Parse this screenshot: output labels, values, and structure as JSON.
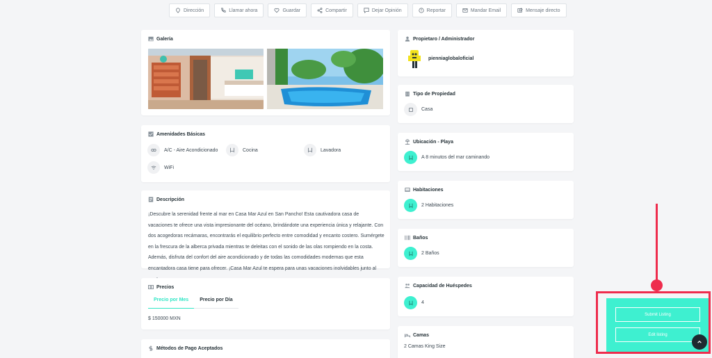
{
  "topbar": {
    "buttons": [
      {
        "label": "Dirección",
        "icon": "map-pin-icon"
      },
      {
        "label": "Llamar ahora",
        "icon": "phone-icon"
      },
      {
        "label": "Guardar",
        "icon": "heart-icon"
      },
      {
        "label": "Compartir",
        "icon": "share-icon"
      },
      {
        "label": "Dejar Opinión",
        "icon": "comment-icon"
      },
      {
        "label": "Reportar",
        "icon": "report-icon"
      },
      {
        "label": "Mandar Email",
        "icon": "email-icon"
      },
      {
        "label": "Mensaje directo",
        "icon": "message-icon"
      }
    ]
  },
  "gallery": {
    "title": "Galería"
  },
  "amenities": {
    "title": "Amenidades Básicas",
    "items": [
      "A/C - Aire Acondicionado",
      "Cocina",
      "Lavadora",
      "WiFi"
    ]
  },
  "description": {
    "title": "Descripción",
    "text": "¡Descubre la serenidad frente al mar en Casa Mar Azul en San Pancho! Esta cautivadora casa de vacaciones te ofrece una vista impresionante del océano, brindándote una experiencia única y relajante. Con dos acogedoras recámaras, encontrarás el equilibrio perfecto entre comodidad y encanto costero. Sumérgete en la frescura de la alberca privada mientras te deleitas con el sonido de las olas rompiendo en la costa. Además, disfruta del confort del aire acondicionado y de todas las comodidades modernas que esta encantadora casa tiene para ofrecer. ¡Casa Mar Azul te espera para unas vacaciones inolvidables junto al mar!"
  },
  "prices": {
    "title": "Precios",
    "tabs": [
      "Precio por Mes",
      "Precio por Día"
    ],
    "value": "$ 150000 MXN"
  },
  "payment": {
    "title": "Métodos de Pago Aceptados"
  },
  "owner": {
    "title": "Propietaro / Administrador",
    "name": "pienniaglobaloficial"
  },
  "property_type": {
    "title": "Tipo de Propiedad",
    "value": "Casa"
  },
  "location": {
    "title": "Ubicación - Playa",
    "value": "A 8 minutos del mar caminando"
  },
  "rooms": {
    "title": "Habitaciones",
    "value": "2 Habitaciones"
  },
  "baths": {
    "title": "Baños",
    "value": "2 Baños"
  },
  "capacity": {
    "title": "Capacidad de Huéspedes",
    "value": "4"
  },
  "beds": {
    "title": "Camas",
    "value": "2 Camas King Size"
  },
  "panel": {
    "submit_label": "Submit Listing",
    "edit_label": "Edit listing"
  },
  "colors": {
    "accent": "#3ef0d0",
    "highlight": "#ee2c4d",
    "background": "#f4f5f7"
  }
}
